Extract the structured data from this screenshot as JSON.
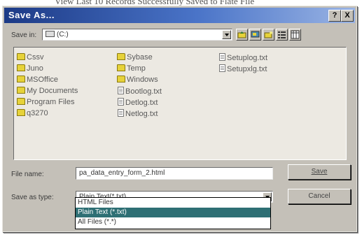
{
  "background_caption": "View Last 10 Records Successfully Saved to Flate File",
  "window": {
    "title": "Save As...",
    "help_glyph": "?",
    "close_glyph": "X"
  },
  "save_in": {
    "label": "Save in:",
    "value": "(C:)"
  },
  "toolbar": {
    "icons": [
      "up-folder-icon",
      "desktop-icon",
      "new-folder-icon",
      "list-view-icon",
      "details-view-icon"
    ]
  },
  "files": {
    "col1": [
      "Cssv",
      "Juno",
      "MSOffice",
      "My Documents",
      "Program Files",
      "q3270"
    ],
    "col2_folders": [
      "Sybase",
      "Temp",
      "Windows"
    ],
    "col2_files": [
      "Bootlog.txt",
      "Detlog.txt",
      "Netlog.txt"
    ],
    "col3_files": [
      "Setuplog.txt",
      "Setupxlg.txt"
    ]
  },
  "file_name": {
    "label": "File name:",
    "value": "pa_data_entry_form_2.html"
  },
  "save_as_type": {
    "label": "Save as type:",
    "value": "Plain Text(*.txt)",
    "options": [
      "HTML Files",
      "Plain Text (*.txt)",
      "All Files (*.*)"
    ],
    "selected_index": 1
  },
  "buttons": {
    "save": "Save",
    "cancel": "Cancel"
  },
  "colors": {
    "title_start": "#1c3a86",
    "title_end": "#9ab4e4",
    "dialog_face": "#c4c0b8",
    "selection": "#2e6f74",
    "folder": "#e6d23a"
  }
}
